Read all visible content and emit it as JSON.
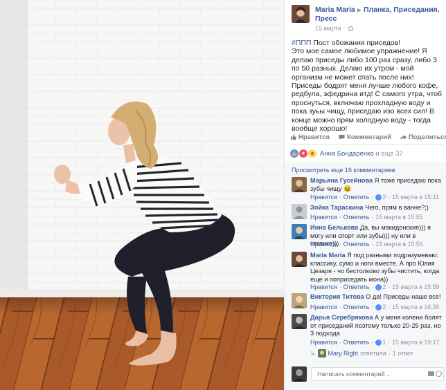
{
  "post": {
    "author": "Maria Maria",
    "group": "Планка, Приседания, Пресс",
    "date": "15 марта",
    "hashtag": "#ППП",
    "title_line": "Пост обожания приседов!",
    "body": "Это мое самое любимое упражнение! Я делаю приседы либо 100 раз сразу, либо 3 по 50 разных. Делаю их утром - мой организм не может спать после них! Приседы бодрят меня лучше любого кофе, редбула, эфедрина итд! С самого утра, чтоб проснуться, включаю прохладную воду и пока зуьы чищу, приседаю изо всех сил! В конце можно прям холодную воду - тогда вообще хорошо!"
  },
  "actions": {
    "like": "Нравится",
    "comment": "Комментарий",
    "share": "Поделиться"
  },
  "reactions": {
    "names": "Анна Бондаренко",
    "rest": "и еще 37"
  },
  "comments_link": "Просмотреть еще 16 комментариев",
  "comment_meta": {
    "like": "Нравится",
    "reply": "Ответить",
    "sep": "·"
  },
  "comments": [
    {
      "name": "Марьяна Гусейнова",
      "text": "Я тоже приседаю пока зубы чищу 😆",
      "likes": "2",
      "date": "15 марта в 15:11"
    },
    {
      "name": "Зойка Тараскина",
      "text": "Чего, прям в ванне?;)",
      "likes": "",
      "date": "15 марта в 15:55"
    },
    {
      "name": "Инна Белькова",
      "text": "Да, вы макидонские))) я могу или спорт или зубы))) ну или в статике)))",
      "likes": "",
      "date": "15 марта в 15:56"
    },
    {
      "name": "Maria Maria",
      "text": "Я под разными подразумеваю: классику, сумо и ноги вместе. А про Юлия Цезаря - чо бестолково зубы чистить, когда еще и поприседать мона))",
      "likes": "2",
      "date": "15 марта в 15:59"
    },
    {
      "name": "Виктория Титова",
      "text": "О да! Приседы наше все!",
      "likes": "2",
      "date": "15 марта в 16:26"
    },
    {
      "name": "Дарья Серебрякова",
      "text": "А у меня колени болят от приседаний поэтому только 20-25 раз, но 3 подхода",
      "likes": "1",
      "date": "15 марта в 19:17"
    }
  ],
  "reply": {
    "name": "Mary Right",
    "text": "ответила",
    "count": "1 ответ"
  },
  "comment_input": {
    "placeholder": "Написать комментарий ..."
  },
  "colors": {
    "link": "#365899",
    "like": "#5890ff",
    "love": "#f25268",
    "wow": "#fcd864",
    "floor": "#a55a2c"
  }
}
